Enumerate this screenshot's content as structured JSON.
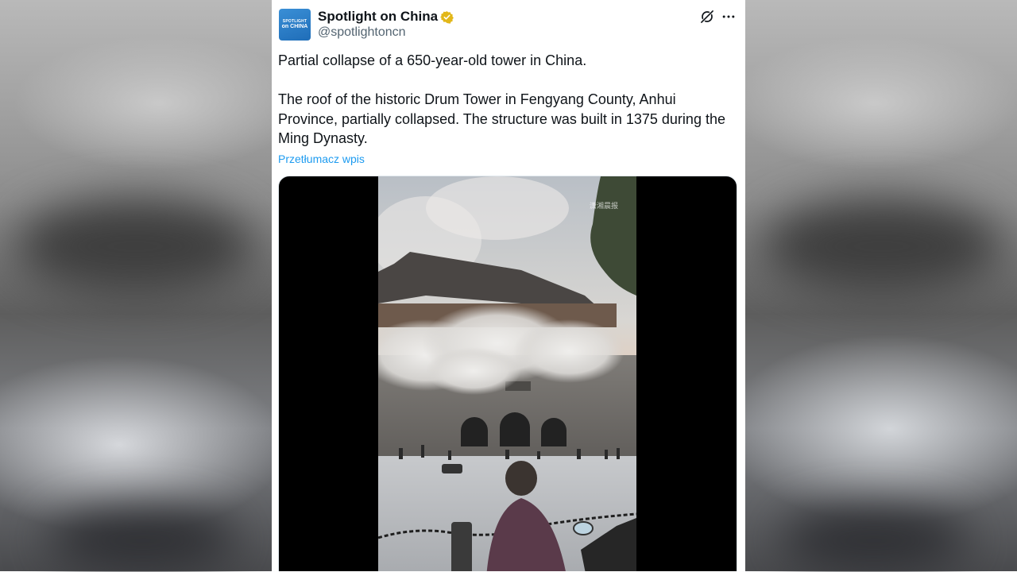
{
  "post": {
    "avatar_line1": "SPOTLIGHT",
    "avatar_line2": "on CHINA",
    "display_name": "Spotlight on China",
    "handle": "@spotlightoncn",
    "text_line1": "Partial collapse of a 650-year-old tower in China.",
    "text_line2": "The roof of the historic Drum Tower in Fengyang County, Anhui Province, partially collapsed. The structure was built in 1375 during the Ming Dynasty.",
    "translate_label": "Przetłumacz wpis"
  },
  "icons": {
    "verified": "verified-badge-icon",
    "grok": "grok-icon",
    "more": "more-dots-icon"
  },
  "colors": {
    "verified_gold": "#e2b719",
    "link_blue": "#1d9bf0",
    "text_primary": "#0f1419",
    "text_secondary": "#536471"
  },
  "media": {
    "watermark": "潇湘晨报"
  }
}
